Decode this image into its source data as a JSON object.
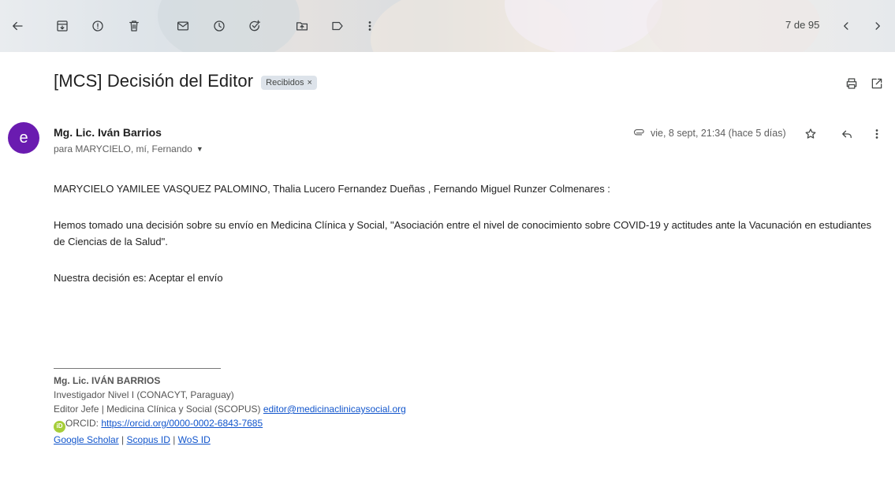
{
  "toolbar": {
    "counter": "7 de 95",
    "icons": [
      "back-arrow-icon",
      "archive-icon",
      "report-spam-icon",
      "delete-icon",
      "mark-unread-icon",
      "snooze-icon",
      "add-to-tasks-icon",
      "move-to-icon",
      "labels-icon",
      "more-vert-icon",
      "newer-icon",
      "older-icon"
    ]
  },
  "email": {
    "subject": "[MCS] Decisión del Editor",
    "label": "Recibidos",
    "label_remove": "×",
    "avatar_letter": "e",
    "avatar_color": "#6a1bb0",
    "sender": "Mg. Lic. Iván Barrios",
    "recipients": "para MARYCIELO, mí, Fernando",
    "date": "vie, 8 sept, 21:34 (hace 5 días)",
    "body": {
      "greeting": "MARYCIELO YAMILEE VASQUEZ PALOMINO, Thalia Lucero Fernandez Dueñas , Fernando Miguel Runzer Colmenares :",
      "paragraph": "Hemos tomado una decisión sobre su envío en Medicina Clínica y Social, \"Asociación entre el nivel de conocimiento sobre COVID-19 y actitudes ante la Vacunación en estudiantes de Ciencias de la Salud\".",
      "decision": "Nuestra decisión es: Aceptar el envío"
    },
    "signature": {
      "name": "Mg. Lic. IVÁN BARRIOS",
      "title": "Investigador Nivel I (CONACYT, Paraguay)",
      "role_prefix": "Editor Jefe | Medicina Clínica y Social (SCOPUS) ",
      "email": "editor@medicinaclinicaysocial.org",
      "orcid_logo": "iD",
      "orcid_prefix": "ORCID: ",
      "orcid_url": "https://orcid.org/0000-0002-6843-7685",
      "links": [
        "Google Scholar",
        "Scopus ID",
        "WoS ID"
      ],
      "separator": " | "
    }
  },
  "colors": {
    "link": "#1155cc",
    "orcid": "#a6ce39"
  }
}
